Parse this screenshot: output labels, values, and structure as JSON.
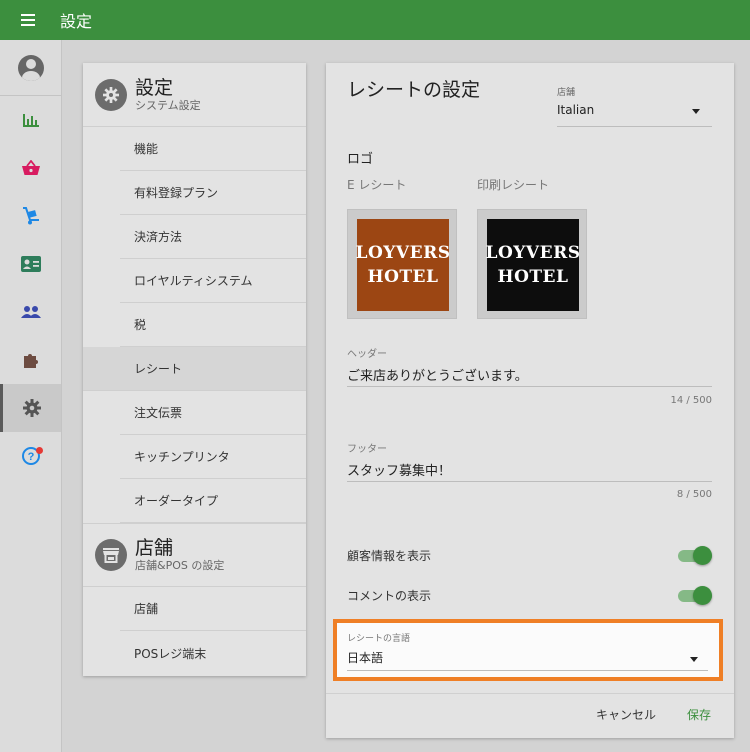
{
  "appbar": {
    "title": "設定"
  },
  "rail": {
    "items": [
      {
        "icon": "bar-chart-icon"
      },
      {
        "icon": "basket-icon"
      },
      {
        "icon": "dolly-icon"
      },
      {
        "icon": "contact-card-icon"
      },
      {
        "icon": "people-icon"
      },
      {
        "icon": "puzzle-icon"
      },
      {
        "icon": "gear-icon",
        "active": true
      },
      {
        "icon": "help-icon"
      }
    ]
  },
  "sidebar": {
    "settings": {
      "title": "設定",
      "subtitle": "システム設定"
    },
    "settings_items": [
      {
        "label": "機能"
      },
      {
        "label": "有料登録プラン"
      },
      {
        "label": "決済方法"
      },
      {
        "label": "ロイヤルティシステム"
      },
      {
        "label": "税"
      },
      {
        "label": "レシート",
        "active": true
      },
      {
        "label": "注文伝票"
      },
      {
        "label": "キッチンプリンタ"
      },
      {
        "label": "オーダータイプ"
      }
    ],
    "store": {
      "title": "店舗",
      "subtitle": "店舗&POS の設定"
    },
    "store_items": [
      {
        "label": "店舗"
      },
      {
        "label": "POSレジ端末"
      }
    ]
  },
  "main": {
    "title": "レシートの設定",
    "store_select": {
      "label": "店舗",
      "value": "Italian"
    },
    "logo": {
      "title": "ロゴ",
      "e_receipt_label": "E レシート",
      "print_receipt_label": "印刷レシート",
      "logo_text_line1": "LOYVERS",
      "logo_text_line2": "HOTEL"
    },
    "header_field": {
      "label": "ヘッダー",
      "value": "ご来店ありがとうございます。",
      "counter": "14 / 500"
    },
    "footer_field": {
      "label": "フッター",
      "value": "スタッフ募集中！",
      "counter": "8 / 500"
    },
    "toggles": {
      "show_customer": {
        "label": "顧客情報を表示",
        "on": true
      },
      "show_comment": {
        "label": "コメントの表示",
        "on": true
      }
    },
    "language_select": {
      "label": "レシートの言語",
      "value": "日本語"
    },
    "actions": {
      "cancel": "キャンセル",
      "save": "保存"
    }
  },
  "colors": {
    "primary": "#3c8f3e",
    "highlight": "#ef7f26",
    "logo_e_bg": "#9c4613",
    "logo_p_bg": "#0d0d0d"
  }
}
